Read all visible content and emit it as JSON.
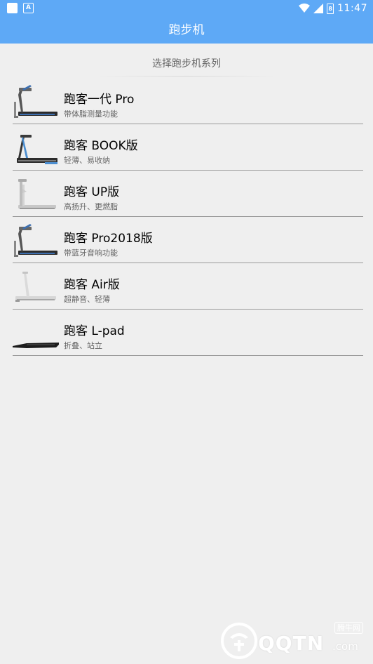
{
  "status_bar": {
    "time": "11:47",
    "battery_text": "8",
    "icons": [
      "square-notification-icon",
      "a-notification-icon",
      "wifi-icon",
      "signal-icon",
      "battery-icon"
    ]
  },
  "app_bar": {
    "title": "跑步机",
    "color": "#5ea9f6"
  },
  "section": {
    "title": "选择跑步机系列"
  },
  "items": [
    {
      "name": "跑客一代 Pro",
      "desc": "带体脂测量功能",
      "icon": "treadmill-pro-image"
    },
    {
      "name": "跑客 BOOK版",
      "desc": "轻薄、易收纳",
      "icon": "treadmill-book-image"
    },
    {
      "name": "跑客 UP版",
      "desc": "高扬升、更燃脂",
      "icon": "treadmill-up-image"
    },
    {
      "name": "跑客 Pro2018版",
      "desc": "带蓝牙音响功能",
      "icon": "treadmill-pro2018-image"
    },
    {
      "name": "跑客 Air版",
      "desc": "超静音、轻薄",
      "icon": "treadmill-air-image"
    },
    {
      "name": "跑客 L-pad",
      "desc": "折叠、站立",
      "icon": "treadmill-lpad-image"
    }
  ],
  "watermark": {
    "badge": "腾牛网",
    "text": "QQTN",
    "suffix": ".com"
  }
}
